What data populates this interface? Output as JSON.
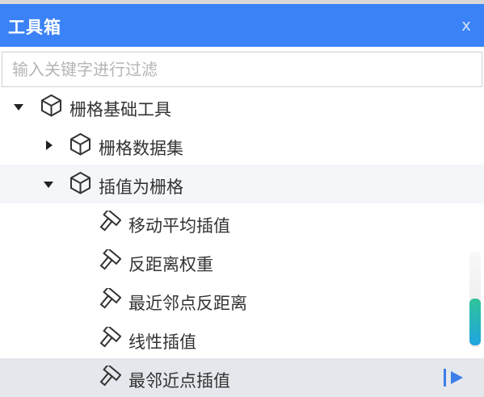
{
  "window": {
    "title": "工具箱",
    "close_label": "x"
  },
  "search": {
    "placeholder": "输入关键字进行过滤",
    "value": ""
  },
  "tree": {
    "root": {
      "label": "栅格基础工具",
      "expanded": true
    },
    "group_dataset": {
      "label": "栅格数据集",
      "expanded": false
    },
    "group_interp": {
      "label": "插值为栅格",
      "expanded": true
    },
    "tools": [
      {
        "label": "移动平均插值"
      },
      {
        "label": "反距离权重"
      },
      {
        "label": "最近邻点反距离"
      },
      {
        "label": "线性插值"
      },
      {
        "label": "最邻近点插值",
        "selected": true
      }
    ]
  },
  "colors": {
    "titlebar": "#3b82f6",
    "selected_row": "#e4e8ec",
    "hover_row": "#f4f6f9",
    "run_icon": "#3b7de9",
    "scroll_thumb": [
      "#2fc39a",
      "#20a5e0"
    ]
  },
  "icons": {
    "group": "cube-icon",
    "tool": "hammer-icon",
    "run": "run-icon"
  }
}
